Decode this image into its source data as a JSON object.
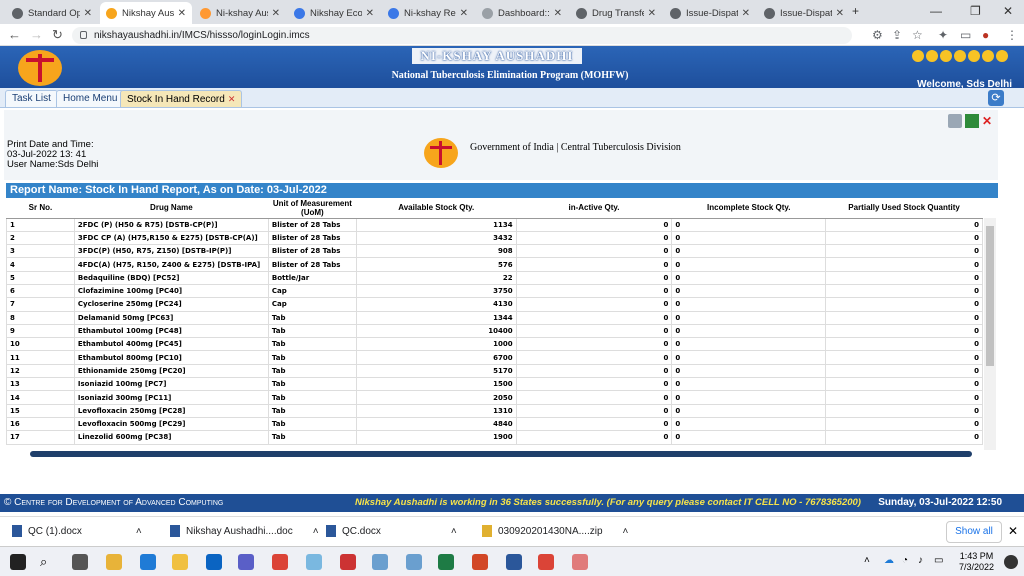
{
  "browser": {
    "tabs": [
      {
        "label": "Standard Ope",
        "color": "#5f6368"
      },
      {
        "label": "Nikshay Aush",
        "color": "#f7a51c",
        "active": true
      },
      {
        "label": "Ni-kshay Aust",
        "color": "#ff9933"
      },
      {
        "label": "Nikshay Ecosy",
        "color": "#3b78e7"
      },
      {
        "label": "Ni-kshay Repo",
        "color": "#3b78e7"
      },
      {
        "label": "Dashboard::N",
        "color": "#9aa0a6"
      },
      {
        "label": "Drug Transfer",
        "color": "#5f6368"
      },
      {
        "label": "Issue-Dispatch",
        "color": "#5f6368"
      },
      {
        "label": "Issue-Dispatch",
        "color": "#5f6368"
      }
    ],
    "url": "nikshayaushadhi.in/IMCS/hissso/loginLogin.imcs"
  },
  "header": {
    "brand": "NI-KSHAY AUSHADHI",
    "subtitle": "National Tuberculosis Elimination Program (MOHFW)",
    "welcome": "Welcome, Sds Delhi"
  },
  "apptabs": [
    {
      "label": "Task List"
    },
    {
      "label": "Home Menu"
    },
    {
      "label": "Stock In Hand Record"
    }
  ],
  "report": {
    "print_label": "Print Date and Time:",
    "print_date": "03-Jul-2022 13: 41",
    "user": "User Name:Sds Delhi",
    "org": "Government of India | Central Tuberculosis Division",
    "name": "Report Name: Stock In Hand Report, As on Date: 03-Jul-2022",
    "columns": [
      "Sr No.",
      "Drug Name",
      "Unit of Measurement (UoM)",
      "Available Stock Qty.",
      "in-Active Qty.",
      "Incomplete Stock Qty.",
      "Partially Used Stock Quantity"
    ],
    "rows": [
      [
        "1",
        "2FDC (P) (H50 & R75) [DSTB-CP(P)]",
        "Blister of 28 Tabs",
        "1134",
        "0",
        "0",
        "0"
      ],
      [
        "2",
        "3FDC CP (A) (H75,R150 & E275) [DSTB-CP(A)]",
        "Blister of 28 Tabs",
        "3432",
        "0",
        "0",
        "0"
      ],
      [
        "3",
        "3FDC(P) (H50, R75, Z150) [DSTB-IP(P)]",
        "Blister of 28 Tabs",
        "908",
        "0",
        "0",
        "0"
      ],
      [
        "4",
        "4FDC(A) (H75, R150, Z400 & E275) [DSTB-IPA]",
        "Blister of 28 Tabs",
        "576",
        "0",
        "0",
        "0"
      ],
      [
        "5",
        "Bedaquiline (BDQ) [PC52]",
        "Bottle/Jar",
        "22",
        "0",
        "0",
        "0"
      ],
      [
        "6",
        "Clofazimine 100mg [PC40]",
        "Cap",
        "3750",
        "0",
        "0",
        "0"
      ],
      [
        "7",
        "Cycloserine 250mg [PC24]",
        "Cap",
        "4130",
        "0",
        "0",
        "0"
      ],
      [
        "8",
        "Delamanid 50mg [PC63]",
        "Tab",
        "1344",
        "0",
        "0",
        "0"
      ],
      [
        "9",
        "Ethambutol 100mg [PC48]",
        "Tab",
        "10400",
        "0",
        "0",
        "0"
      ],
      [
        "10",
        "Ethambutol 400mg [PC45]",
        "Tab",
        "1000",
        "0",
        "0",
        "0"
      ],
      [
        "11",
        "Ethambutol 800mg [PC10]",
        "Tab",
        "6700",
        "0",
        "0",
        "0"
      ],
      [
        "12",
        "Ethionamide 250mg [PC20]",
        "Tab",
        "5170",
        "0",
        "0",
        "0"
      ],
      [
        "13",
        "Isoniazid 100mg [PC7]",
        "Tab",
        "1500",
        "0",
        "0",
        "0"
      ],
      [
        "14",
        "Isoniazid 300mg [PC11]",
        "Tab",
        "2050",
        "0",
        "0",
        "0"
      ],
      [
        "15",
        "Levofloxacin 250mg [PC28]",
        "Tab",
        "1310",
        "0",
        "0",
        "0"
      ],
      [
        "16",
        "Levofloxacin 500mg [PC29]",
        "Tab",
        "4840",
        "0",
        "0",
        "0"
      ],
      [
        "17",
        "Linezolid 600mg [PC38]",
        "Tab",
        "1900",
        "0",
        "0",
        "0"
      ]
    ]
  },
  "footer": {
    "cdac": "© Centre for Development of Advanced Computing",
    "ticker": "Nikshay Aushadhi is working in 36 States successfully. (For any query please contact IT CELL NO - 7678365200)",
    "datetime": "Sunday, 03-Jul-2022 12:50"
  },
  "downloads": {
    "items": [
      {
        "label": "QC (1).docx"
      },
      {
        "label": "Nikshay Aushadhi....doc"
      },
      {
        "label": "QC.docx"
      },
      {
        "label": "030920201430NA....zip"
      }
    ],
    "show_all": "Show all"
  },
  "taskbar": {
    "time": "1:43 PM",
    "date": "7/3/2022"
  }
}
